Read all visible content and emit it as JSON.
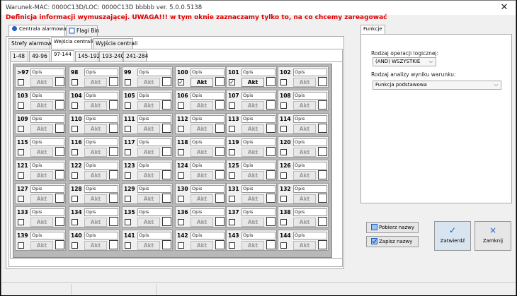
{
  "window": {
    "title": "Warunek-MAC: 0000C13D/LOC: 0000C13D bbbbb ver. 5.0.0.5138",
    "close": "✕"
  },
  "warning": "Definicja informacji wymuszającej. UWAGA!!! w tym oknie zaznaczamy tylko to, na co chcemy zareagować",
  "top_tabs": [
    "Centrala alarmowa",
    "Flagi Bin"
  ],
  "sub_tabs": [
    "Strefy alarmowe",
    "Wejścia centrali",
    "Wyjścia centrali"
  ],
  "range_tabs": [
    "1-48",
    "49-96",
    "97-144",
    "145-192",
    "193-240",
    "241-284"
  ],
  "grid": {
    "opis": "Opis",
    "akt": "Akt",
    "cells": [
      {
        "n": ">97",
        "c": false,
        "a": false
      },
      {
        "n": "98",
        "c": false,
        "a": false
      },
      {
        "n": "99",
        "c": false,
        "a": false
      },
      {
        "n": "100",
        "c": true,
        "a": true
      },
      {
        "n": "101",
        "c": true,
        "a": true
      },
      {
        "n": "102",
        "c": false,
        "a": false
      },
      {
        "n": "103",
        "c": false,
        "a": false
      },
      {
        "n": "104",
        "c": false,
        "a": false
      },
      {
        "n": "105",
        "c": false,
        "a": false
      },
      {
        "n": "106",
        "c": false,
        "a": false
      },
      {
        "n": "107",
        "c": false,
        "a": false
      },
      {
        "n": "108",
        "c": false,
        "a": false
      },
      {
        "n": "109",
        "c": false,
        "a": false
      },
      {
        "n": "110",
        "c": false,
        "a": false
      },
      {
        "n": "111",
        "c": false,
        "a": false
      },
      {
        "n": "112",
        "c": false,
        "a": false
      },
      {
        "n": "113",
        "c": false,
        "a": false
      },
      {
        "n": "114",
        "c": false,
        "a": false
      },
      {
        "n": "115",
        "c": false,
        "a": false
      },
      {
        "n": "116",
        "c": false,
        "a": false
      },
      {
        "n": "117",
        "c": false,
        "a": false
      },
      {
        "n": "118",
        "c": false,
        "a": false
      },
      {
        "n": "119",
        "c": false,
        "a": false
      },
      {
        "n": "120",
        "c": false,
        "a": false
      },
      {
        "n": "121",
        "c": false,
        "a": false
      },
      {
        "n": "122",
        "c": false,
        "a": false
      },
      {
        "n": "123",
        "c": false,
        "a": false
      },
      {
        "n": "124",
        "c": false,
        "a": false
      },
      {
        "n": "125",
        "c": false,
        "a": false
      },
      {
        "n": "126",
        "c": false,
        "a": false
      },
      {
        "n": "127",
        "c": false,
        "a": false
      },
      {
        "n": "128",
        "c": false,
        "a": false
      },
      {
        "n": "129",
        "c": false,
        "a": false
      },
      {
        "n": "130",
        "c": false,
        "a": false
      },
      {
        "n": "131",
        "c": false,
        "a": false
      },
      {
        "n": "132",
        "c": false,
        "a": false
      },
      {
        "n": "133",
        "c": false,
        "a": false
      },
      {
        "n": "134",
        "c": false,
        "a": false
      },
      {
        "n": "135",
        "c": false,
        "a": false
      },
      {
        "n": "136",
        "c": false,
        "a": false
      },
      {
        "n": "137",
        "c": false,
        "a": false
      },
      {
        "n": "138",
        "c": false,
        "a": false
      },
      {
        "n": "139",
        "c": false,
        "a": false
      },
      {
        "n": "140",
        "c": false,
        "a": false
      },
      {
        "n": "141",
        "c": false,
        "a": false
      },
      {
        "n": "142",
        "c": false,
        "a": false
      },
      {
        "n": "143",
        "c": false,
        "a": false
      },
      {
        "n": "144",
        "c": false,
        "a": false
      }
    ]
  },
  "right": {
    "tab": "Funkcje",
    "logic_label": "Rodzaj operacji logicznej:",
    "logic_value": "(AND) WSZYSTKIE",
    "analysis_label": "Rodzaj analizy wyniku warunku:",
    "analysis_value": "Funkcja podstawowa"
  },
  "buttons": {
    "get_names": "Pobierz nazwy",
    "save_names": "Zapisz nazwy",
    "confirm": "Zatwierdź",
    "close": "Zamknij",
    "confirm_icon": "✓",
    "close_icon": "×"
  },
  "colors": {
    "warning": "#e00000",
    "accent": "#2060c0"
  }
}
